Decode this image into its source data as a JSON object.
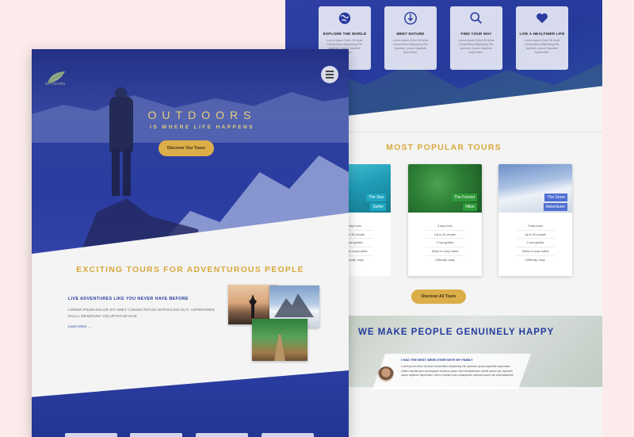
{
  "back": {
    "features": [
      {
        "icon": "globe-icon",
        "title": "EXPLORE THE WORLD",
        "text": "Lorem Ipsum Dolor Sit Amet Consectetur Adipisicing Elit. Aperiam, Ipsum Sapiente Aspernatur."
      },
      {
        "icon": "compass-icon",
        "title": "MEET NATURE",
        "text": "Lorem Ipsum Dolor Sit Amet Consectetur Adipisicing Elit. Aperiam, Ipsum Sapiente Aspernatur."
      },
      {
        "icon": "magnifier-icon",
        "title": "FIND YOUR WAY",
        "text": "Lorem Ipsum Dolor Sit Amet Consectetur Adipisicing Elit. Aperiam, Ipsum Sapiente Aspernatur."
      },
      {
        "icon": "heart-icon",
        "title": "LIVE A HEALTHIER LIFE",
        "text": "Lorem Ipsum Dolor Sit Amet Consectetur Adipisicing Elit. Aperiam, Ipsum Sapiente Aspernatur."
      }
    ],
    "tours_title": "MOST POPULAR TOURS",
    "tours": [
      {
        "name1": "The Sea",
        "name2": "Surfer",
        "details": [
          "3 day tours",
          "Up to 30 people",
          "2 tour guides",
          "Sleep in cozy hotels",
          "Difficulty: easy"
        ]
      },
      {
        "name1": "The Forrest",
        "name2": "Hiker",
        "details": [
          "3 day tours",
          "Up to 30 people",
          "2 tour guides",
          "Sleep in cozy hotels",
          "Difficulty: easy"
        ]
      },
      {
        "name1": "The Snow",
        "name2": "Adventurer",
        "details": [
          "3 day tours",
          "Up to 30 people",
          "2 tour guides",
          "Sleep in cozy hotels",
          "Difficulty: easy"
        ]
      }
    ],
    "discover_all": "Discover All Tours",
    "stories_title": "WE MAKE PEOPLE GENUINELY HAPPY",
    "story_heading": "I HAD THE BEST WEEK EVER WITH MY FAMILY",
    "story_text": "Lorem ipsum dolor sit amet consectetur adipisicing elit. Aperiam, ipsum sapiente aspernatur. Libero repellat quis consequatur ducimus quam nisi exercitationem omnis earum qui. Aperiam, ipsum sapiente aspernatur. Libero repellat quis consequatur ducimus quam nisi exercitationem"
  },
  "front": {
    "logo_text": "NATOURS",
    "hero_title": "OUTDOORS",
    "hero_sub": "IS WHERE LIFE HAPPENS",
    "discover_tours": "Discover Our Tours",
    "about_title": "EXCITING TOURS FOR ADVENTUROUS PEOPLE",
    "about_heading": "LIVE ADVENTURES LIKE YOU NEVER HAVE BEFORE",
    "about_text": "LOREM IPSUM DOLOR SIT AMET CONSECTETUR ADIPISICING ELIT. ASPERIORES NULLA DESERUNT VOLUPTATUM NAM",
    "learn_more": "Learn More →"
  },
  "colors": {
    "brand_blue": "#2a3ca0",
    "gold": "#dcae49",
    "heading_gold": "#d8a93c"
  }
}
